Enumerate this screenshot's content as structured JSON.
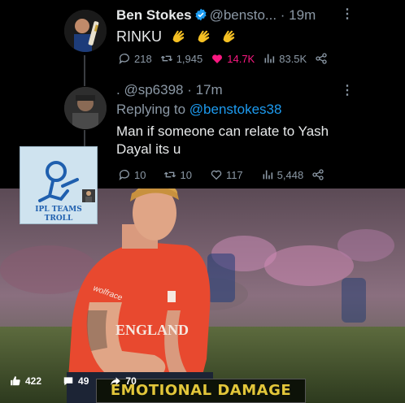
{
  "tweet1": {
    "name": "Ben Stokes",
    "handle": "@bensto...",
    "time": "· 19m",
    "text": "RINKU",
    "actions": {
      "replies": "218",
      "retweets": "1,945",
      "likes": "14.7K",
      "views": "83.5K"
    }
  },
  "tweet2": {
    "handle": ". @sp6398",
    "time": "· 17m",
    "replying_to_prefix": "Replying to",
    "replying_to": "@benstokes38",
    "text": "Man if someone can relate to Yash Dayal its u",
    "actions": {
      "replies": "10",
      "retweets": "10",
      "likes": "117",
      "views": "5,448"
    }
  },
  "logo": {
    "line1": "IPL TEAMS",
    "line2": "TROLL"
  },
  "jersey": {
    "brand": "wolfrace",
    "country": "ENGLAND"
  },
  "caption": "EMOTIONAL DAMAGE",
  "facebook_bar": {
    "likes": "422",
    "comments": "49",
    "shares": "70"
  },
  "colors": {
    "background": "#000000",
    "like_pink": "#f91880",
    "link_blue": "#1d9bf0",
    "caption_yellow": "#e2c63a"
  }
}
